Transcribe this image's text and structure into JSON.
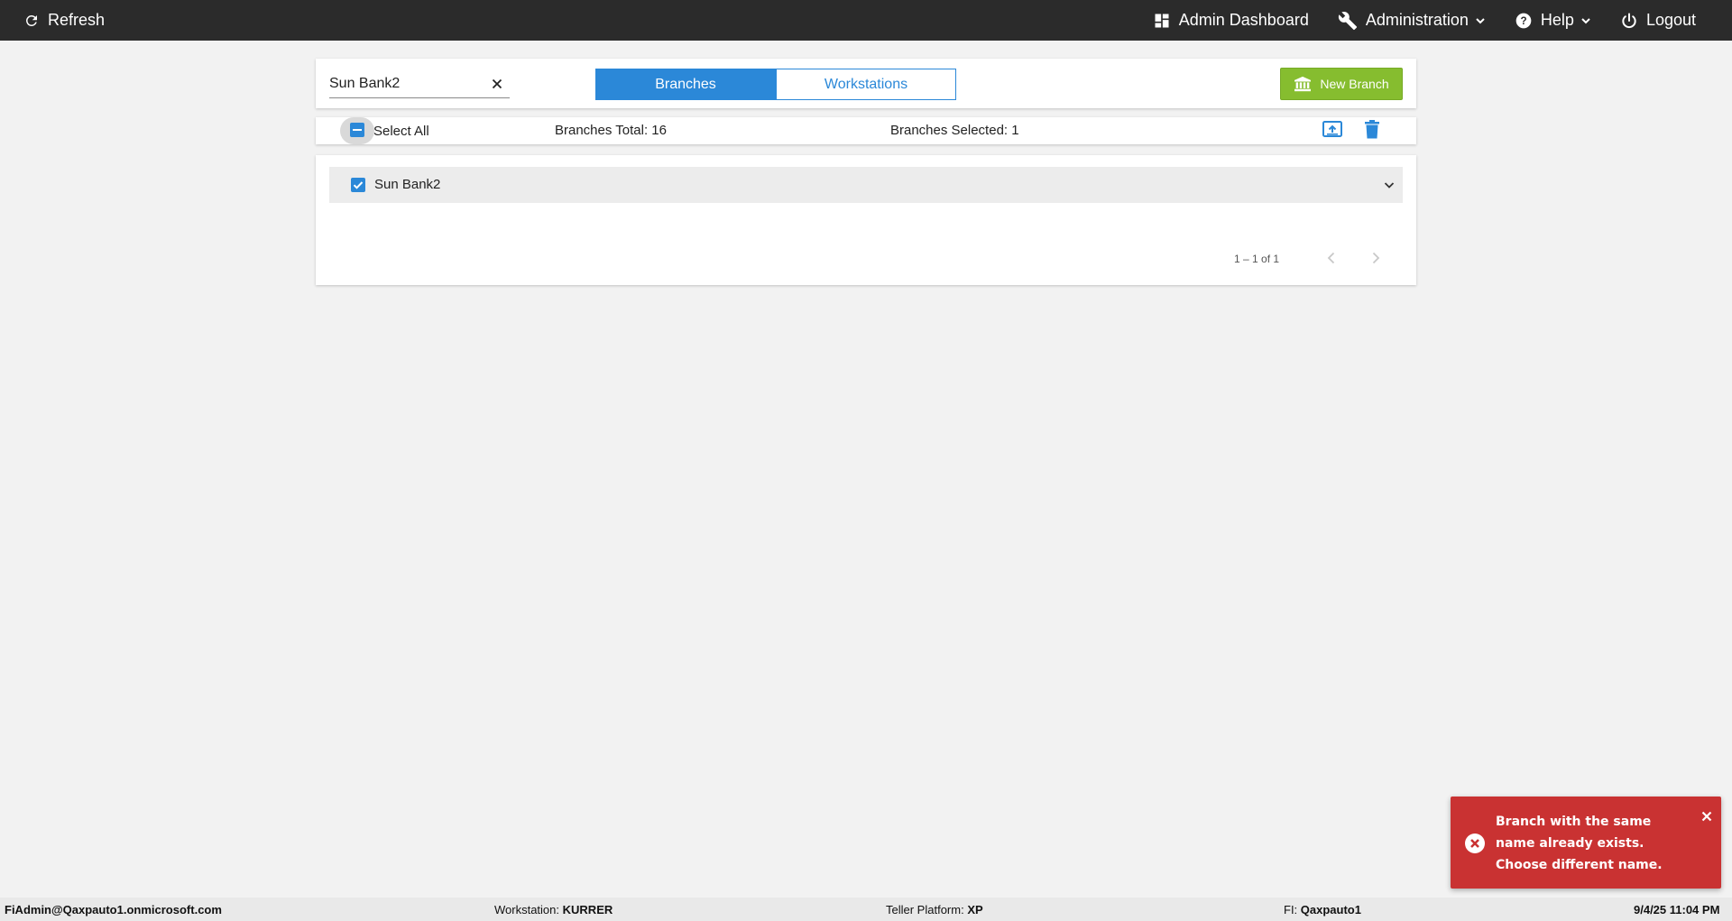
{
  "topbar": {
    "refresh_label": "Refresh",
    "admin_dashboard_label": "Admin Dashboard",
    "administration_label": "Administration",
    "help_label": "Help",
    "logout_label": "Logout"
  },
  "search": {
    "value": "Sun Bank2"
  },
  "tabs": {
    "branches_label": "Branches",
    "workstations_label": "Workstations",
    "active": "Branches"
  },
  "new_branch_label": "New Branch",
  "toolbar": {
    "select_all_label": "Select All",
    "branches_total": "Branches Total: 16",
    "branches_selected": "Branches Selected: 1"
  },
  "list": {
    "items": [
      {
        "label": "Sun Bank2",
        "checked": true
      }
    ],
    "pager": "1 – 1 of 1"
  },
  "toast": {
    "message": "Branch with the same name already exists. Choose different name."
  },
  "footer": {
    "user": "FiAdmin@Qaxpauto1.onmicrosoft.com",
    "workstation_label": "Workstation:",
    "workstation_value": "KURRER",
    "teller_platform_label": "Teller Platform:",
    "teller_platform_value": "XP",
    "fi_label": "FI:",
    "fi_value": "Qaxpauto1",
    "datetime": "9/4/25 11:04 PM"
  },
  "colors": {
    "topbar": "#2b2b2b",
    "accent_blue": "#2b88d8",
    "new_branch_green": "#86bd2f",
    "toast_red": "#c93232",
    "page_bg": "#f2f2f2"
  }
}
